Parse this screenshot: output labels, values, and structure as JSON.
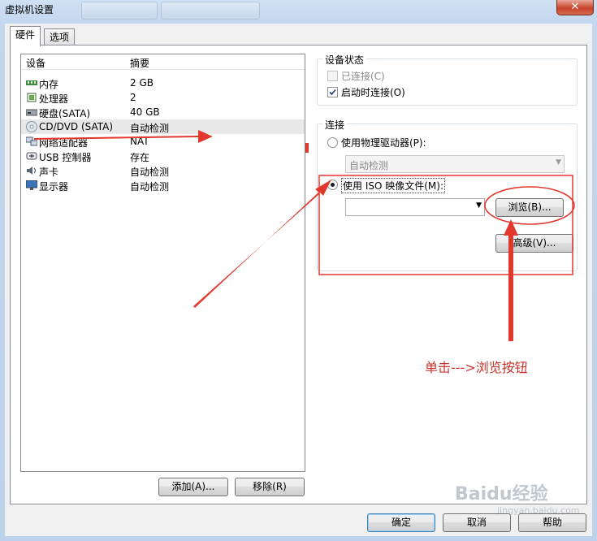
{
  "window": {
    "title": "虚拟机设置"
  },
  "tabs": [
    {
      "label": "硬件"
    },
    {
      "label": "选项"
    }
  ],
  "devices": {
    "header": {
      "device": "设备",
      "summary": "摘要"
    },
    "rows": [
      {
        "name": "内存",
        "summary": "2 GB",
        "icon": "memory-icon"
      },
      {
        "name": "处理器",
        "summary": "2",
        "icon": "cpu-icon"
      },
      {
        "name": "硬盘(SATA)",
        "summary": "40 GB",
        "icon": "harddisk-icon"
      },
      {
        "name": "CD/DVD (SATA)",
        "summary": "自动检测",
        "icon": "cd-dvd-icon"
      },
      {
        "name": "网络适配器",
        "summary": "NAT",
        "icon": "network-icon"
      },
      {
        "name": "USB 控制器",
        "summary": "存在",
        "icon": "usb-icon"
      },
      {
        "name": "声卡",
        "summary": "自动检测",
        "icon": "sound-icon"
      },
      {
        "name": "显示器",
        "summary": "自动检测",
        "icon": "display-icon"
      }
    ],
    "add_label": "添加(A)...",
    "remove_label": "移除(R)"
  },
  "device_status": {
    "title": "设备状态",
    "connected_label": "已连接(C)",
    "connected": false,
    "connect_on_power_label": "启动时连接(O)",
    "connect_on_power": true
  },
  "connection": {
    "title": "连接",
    "physical_drive_label": "使用物理驱动器(P):",
    "physical_drive_value": "自动检测",
    "iso_label": "使用 ISO 映像文件(M):",
    "iso_value": "",
    "browse_label": "浏览(B)...",
    "advanced_label": "高级(V)..."
  },
  "footer": {
    "ok_label": "确定",
    "cancel_label": "取消",
    "help_label": "帮助"
  },
  "annotation": {
    "text": "单击--->浏览按钮",
    "color": "#c8332b"
  },
  "watermark": {
    "text": "Baidu经验",
    "sub": "jingyan.baidu.com"
  }
}
